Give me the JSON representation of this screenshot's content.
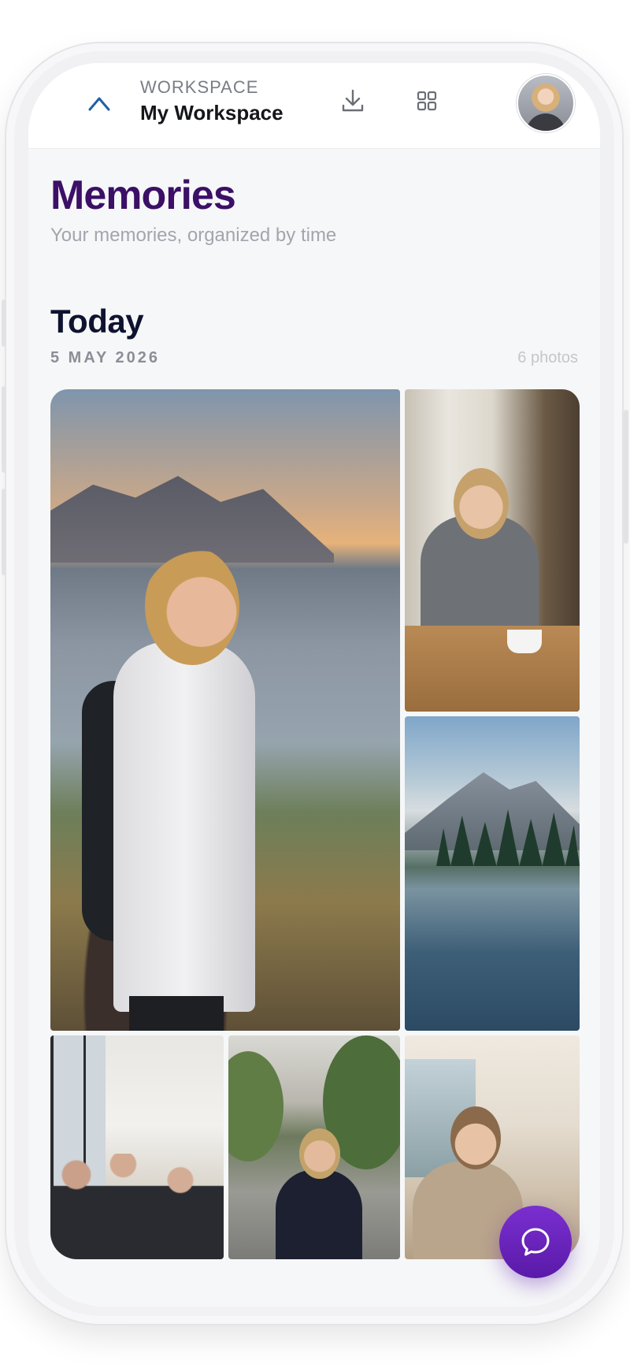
{
  "header": {
    "workspace_label": "WORKSPACE",
    "workspace_name": "My Workspace",
    "icons": [
      "chevron-up-icon",
      "download-icon",
      "grid-icon",
      "avatar"
    ]
  },
  "page": {
    "title": "Memories",
    "subtitle": "Your memories, organized by time"
  },
  "section": {
    "title": "Today",
    "date": "5 MAY 2026",
    "count": "6 photos"
  },
  "photos": [
    {
      "subject": "woman with backpack on coastal mountain at sunset"
    },
    {
      "subject": "woman writing in a café with coffee"
    },
    {
      "subject": "mountain lake reflection with pine trees"
    },
    {
      "subject": "team meeting in an office"
    },
    {
      "subject": "woman walking on a city street"
    },
    {
      "subject": "woman cooking in a kitchen"
    }
  ],
  "fab": {
    "icon": "chat-bubble-icon"
  },
  "colors": {
    "title": "#3b1066",
    "accent": "#6a22bd",
    "chevron": "#1f5fa8"
  }
}
